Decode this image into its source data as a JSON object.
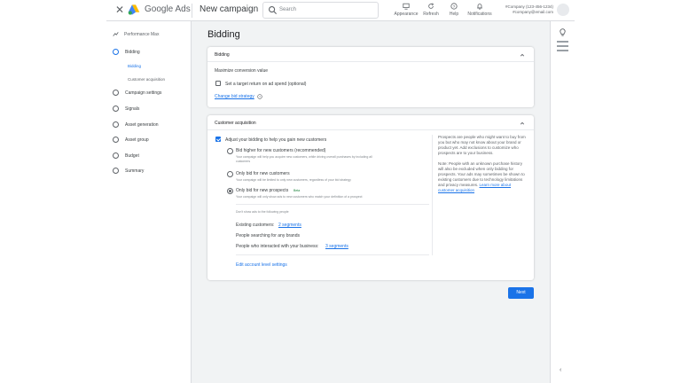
{
  "header": {
    "brand": "Google Ads",
    "page_title": "New campaign",
    "search_placeholder": "Search",
    "buttons": [
      {
        "label": "Appearance",
        "icon": "monitor-icon"
      },
      {
        "label": "Refresh",
        "icon": "refresh-icon"
      },
      {
        "label": "Help",
        "icon": "help-icon"
      },
      {
        "label": "Notifications",
        "icon": "bell-icon"
      }
    ],
    "account_line1": "#Company (123-456-1234)",
    "account_line2": "#company@email.com"
  },
  "nav": {
    "top": "Performance Max",
    "items": [
      {
        "label": "Bidding",
        "active": true
      },
      {
        "label": "Campaign settings"
      },
      {
        "label": "Signals"
      },
      {
        "label": "Asset generation"
      },
      {
        "label": "Asset group"
      },
      {
        "label": "Budget"
      },
      {
        "label": "Summary"
      }
    ],
    "subitems": [
      {
        "label": "Bidding",
        "active": true
      },
      {
        "label": "Customer acquisition"
      }
    ]
  },
  "main": {
    "title": "Bidding",
    "bidding_card": {
      "header": "Bidding",
      "strategy": "Maximize conversion value",
      "checkbox_label": "Set a target return on ad spend (optional)",
      "change_link": "Change bid strategy"
    },
    "acquisition_card": {
      "header": "Customer acquisition",
      "main_checkbox": "Adjust your bidding to help you gain new customers",
      "options": [
        {
          "title": "Bid higher for new customers (recommended)",
          "desc1": "Your campaign will help you acquire new customers, while driving overall purchases by including all",
          "desc2": "customers"
        },
        {
          "title": "Only bid for new customers",
          "desc1": "Your campaign will be limited to only new customers, regardless of your bid strategy",
          "desc2": ""
        },
        {
          "title": "Only bid for new prospects",
          "badge": "Beta",
          "desc1": "Your campaign will only show ads to new customers who match your definition of a prospect",
          "desc2": ""
        }
      ],
      "dont_show": "Don't show ads to the following people",
      "existing_label": "Existing customers:",
      "existing_value": "2 segments",
      "searching": "People searching for any brands",
      "interacted_label": "People who interacted with your business:",
      "interacted_value": "3 segments",
      "edit_link": "Edit account level settings",
      "side_p1": "Prospects are people who might want to buy from you but who may not know about your brand or product yet. Add exclusions to customize who prospects are to your business.",
      "side_p2": "Note: People with an unknown purchase history will also be excluded when only bidding for prospects. Your ads may sometimes be shown to existing customers due to technology limitations and privacy measures.",
      "side_link": "Learn more about customer acquisition"
    },
    "next_label": "Next"
  }
}
